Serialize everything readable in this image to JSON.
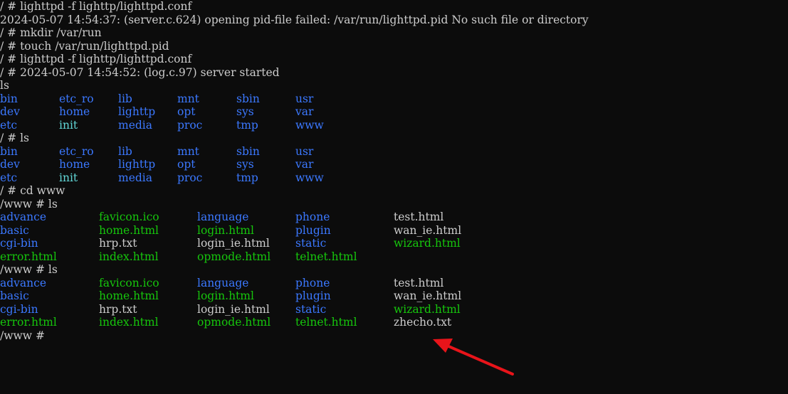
{
  "terminal": {
    "background": "#0c0c0c",
    "lines": [
      {
        "type": "text",
        "text": "/ # lighttpd -f lighttp/lighttpd.conf"
      },
      {
        "type": "text",
        "text": "2024-05-07 14:54:37: (server.c.624) opening pid-file failed: /var/run/lighttpd.pid No such file or directory"
      },
      {
        "type": "text",
        "text": "/ # mkdir /var/run"
      },
      {
        "type": "text",
        "text": "/ # touch /var/run/lighttpd.pid"
      },
      {
        "type": "text",
        "text": "/ # lighttpd -f lighttp/lighttpd.conf"
      },
      {
        "type": "text",
        "text": "/ # 2024-05-07 14:54:52: (log.c.97) server started"
      },
      {
        "type": "text",
        "text": "ls"
      },
      {
        "type": "cols",
        "layout": "root",
        "cells": [
          {
            "t": "bin",
            "k": "dir"
          },
          {
            "t": "etc_ro",
            "k": "dir"
          },
          {
            "t": "lib",
            "k": "dir"
          },
          {
            "t": "mnt",
            "k": "dir"
          },
          {
            "t": "sbin",
            "k": "dir"
          },
          {
            "t": "usr",
            "k": "dir"
          }
        ]
      },
      {
        "type": "cols",
        "layout": "root",
        "cells": [
          {
            "t": "dev",
            "k": "dir"
          },
          {
            "t": "home",
            "k": "dir"
          },
          {
            "t": "lighttp",
            "k": "dir"
          },
          {
            "t": "opt",
            "k": "dir"
          },
          {
            "t": "sys",
            "k": "dir"
          },
          {
            "t": "var",
            "k": "dir"
          }
        ]
      },
      {
        "type": "cols",
        "layout": "root",
        "cells": [
          {
            "t": "etc",
            "k": "dir"
          },
          {
            "t": "init",
            "k": "link"
          },
          {
            "t": "media",
            "k": "dir"
          },
          {
            "t": "proc",
            "k": "dir"
          },
          {
            "t": "tmp",
            "k": "dir"
          },
          {
            "t": "www",
            "k": "dir"
          }
        ]
      },
      {
        "type": "text",
        "text": "/ # ls"
      },
      {
        "type": "cols",
        "layout": "root",
        "cells": [
          {
            "t": "bin",
            "k": "dir"
          },
          {
            "t": "etc_ro",
            "k": "dir"
          },
          {
            "t": "lib",
            "k": "dir"
          },
          {
            "t": "mnt",
            "k": "dir"
          },
          {
            "t": "sbin",
            "k": "dir"
          },
          {
            "t": "usr",
            "k": "dir"
          }
        ]
      },
      {
        "type": "cols",
        "layout": "root",
        "cells": [
          {
            "t": "dev",
            "k": "dir"
          },
          {
            "t": "home",
            "k": "dir"
          },
          {
            "t": "lighttp",
            "k": "dir"
          },
          {
            "t": "opt",
            "k": "dir"
          },
          {
            "t": "sys",
            "k": "dir"
          },
          {
            "t": "var",
            "k": "dir"
          }
        ]
      },
      {
        "type": "cols",
        "layout": "root",
        "cells": [
          {
            "t": "etc",
            "k": "dir"
          },
          {
            "t": "init",
            "k": "link"
          },
          {
            "t": "media",
            "k": "dir"
          },
          {
            "t": "proc",
            "k": "dir"
          },
          {
            "t": "tmp",
            "k": "dir"
          },
          {
            "t": "www",
            "k": "dir"
          }
        ]
      },
      {
        "type": "text",
        "text": "/ # cd www"
      },
      {
        "type": "text",
        "text": "/www # ls"
      },
      {
        "type": "cols",
        "layout": "www",
        "cells": [
          {
            "t": "advance",
            "k": "dir"
          },
          {
            "t": "favicon.ico",
            "k": "exec"
          },
          {
            "t": "language",
            "k": "dir"
          },
          {
            "t": "phone",
            "k": "dir"
          },
          {
            "t": "test.html",
            "k": "text"
          }
        ]
      },
      {
        "type": "cols",
        "layout": "www",
        "cells": [
          {
            "t": "basic",
            "k": "dir"
          },
          {
            "t": "home.html",
            "k": "exec"
          },
          {
            "t": "login.html",
            "k": "exec"
          },
          {
            "t": "plugin",
            "k": "dir"
          },
          {
            "t": "wan_ie.html",
            "k": "text"
          }
        ]
      },
      {
        "type": "cols",
        "layout": "www",
        "cells": [
          {
            "t": "cgi-bin",
            "k": "dir"
          },
          {
            "t": "hrp.txt",
            "k": "text"
          },
          {
            "t": "login_ie.html",
            "k": "text"
          },
          {
            "t": "static",
            "k": "dir"
          },
          {
            "t": "wizard.html",
            "k": "exec"
          }
        ]
      },
      {
        "type": "cols",
        "layout": "www",
        "cells": [
          {
            "t": "error.html",
            "k": "exec"
          },
          {
            "t": "index.html",
            "k": "exec"
          },
          {
            "t": "opmode.html",
            "k": "exec"
          },
          {
            "t": "telnet.html",
            "k": "exec"
          }
        ]
      },
      {
        "type": "text",
        "text": "/www # ls"
      },
      {
        "type": "cols",
        "layout": "www",
        "cells": [
          {
            "t": "advance",
            "k": "dir"
          },
          {
            "t": "favicon.ico",
            "k": "exec"
          },
          {
            "t": "language",
            "k": "dir"
          },
          {
            "t": "phone",
            "k": "dir"
          },
          {
            "t": "test.html",
            "k": "text"
          }
        ]
      },
      {
        "type": "cols",
        "layout": "www",
        "cells": [
          {
            "t": "basic",
            "k": "dir"
          },
          {
            "t": "home.html",
            "k": "exec"
          },
          {
            "t": "login.html",
            "k": "exec"
          },
          {
            "t": "plugin",
            "k": "dir"
          },
          {
            "t": "wan_ie.html",
            "k": "text"
          }
        ]
      },
      {
        "type": "cols",
        "layout": "www",
        "cells": [
          {
            "t": "cgi-bin",
            "k": "dir"
          },
          {
            "t": "hrp.txt",
            "k": "text"
          },
          {
            "t": "login_ie.html",
            "k": "text"
          },
          {
            "t": "static",
            "k": "dir"
          },
          {
            "t": "wizard.html",
            "k": "exec"
          }
        ]
      },
      {
        "type": "cols",
        "layout": "www",
        "cells": [
          {
            "t": "error.html",
            "k": "exec"
          },
          {
            "t": "index.html",
            "k": "exec"
          },
          {
            "t": "opmode.html",
            "k": "exec"
          },
          {
            "t": "telnet.html",
            "k": "exec"
          },
          {
            "t": "zhecho.txt",
            "k": "text"
          }
        ]
      },
      {
        "type": "text",
        "text": "/www # "
      }
    ]
  },
  "annotation": {
    "color": "#e8141a",
    "icon": "red-arrow-icon"
  }
}
